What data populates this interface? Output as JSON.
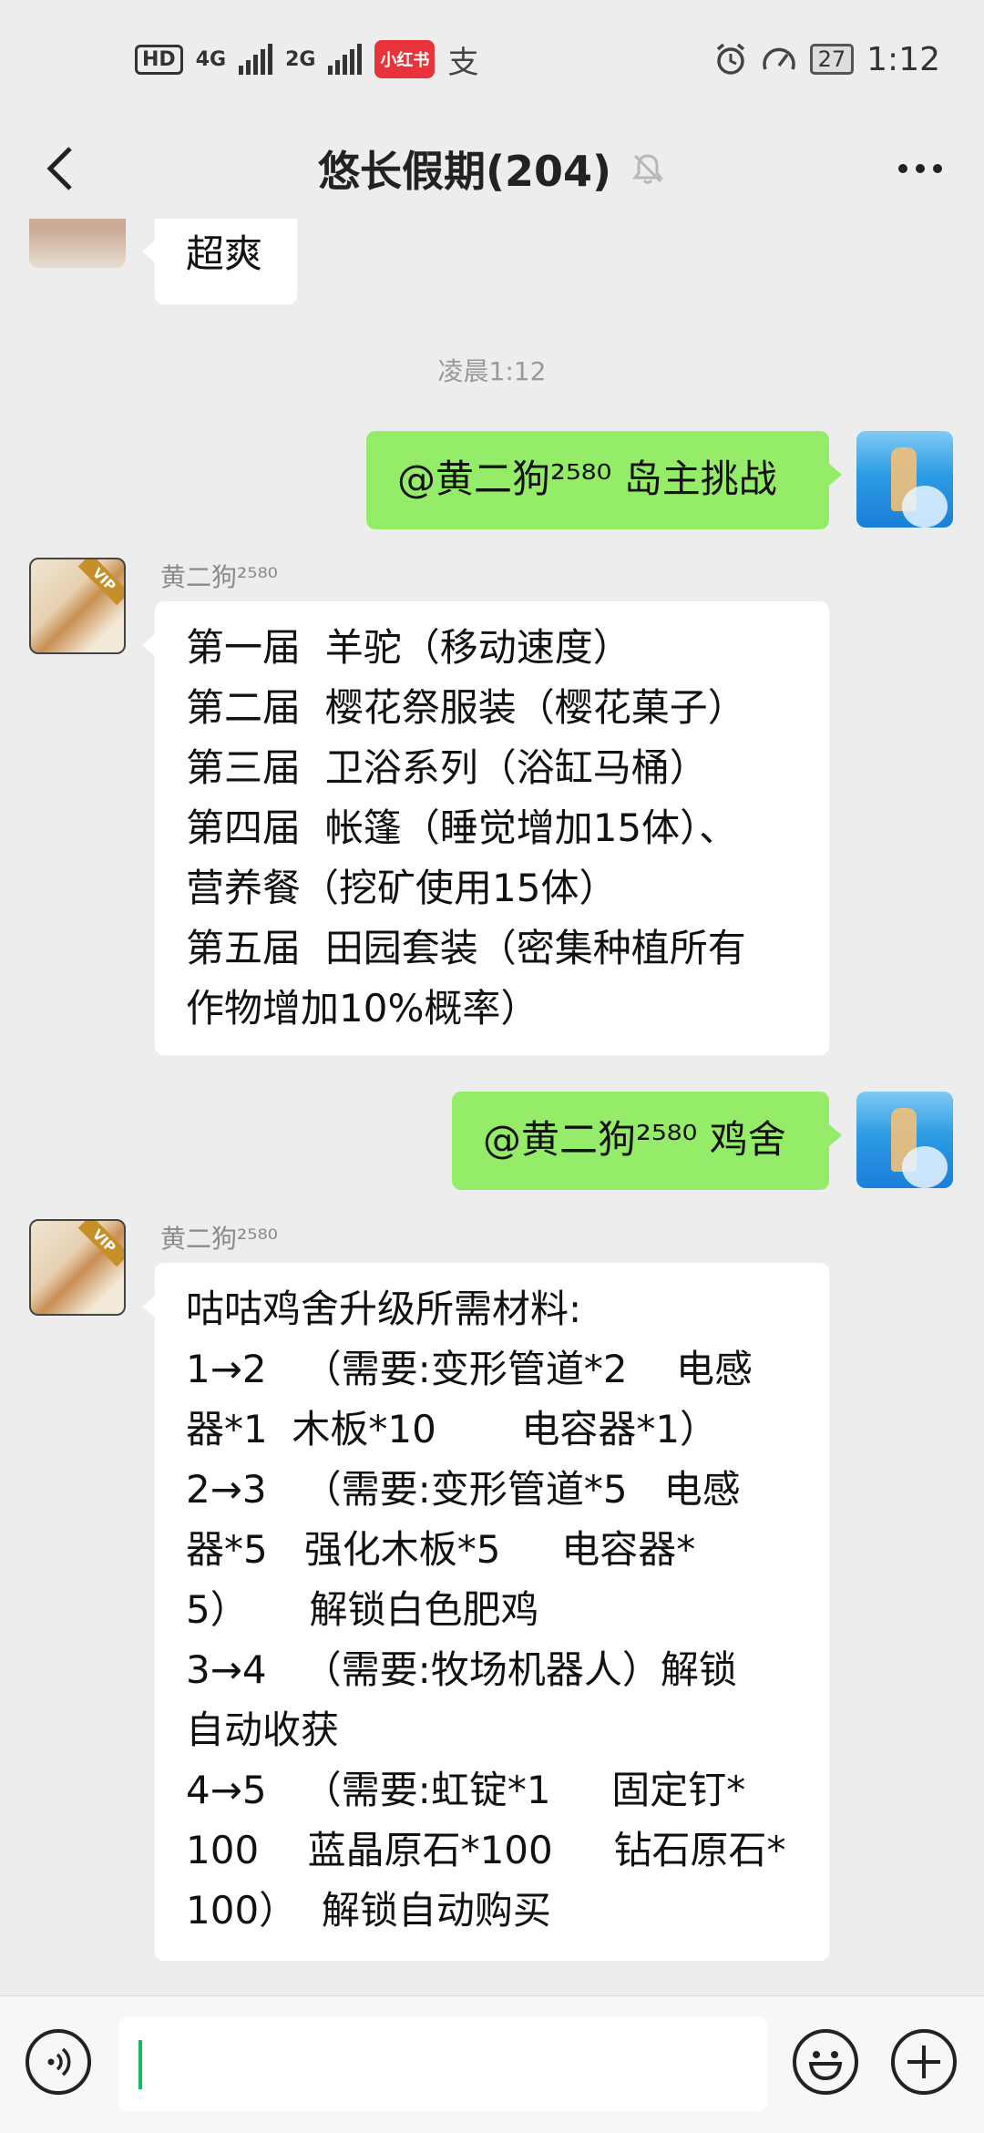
{
  "status_bar": {
    "hd": "HD",
    "net1": "4G",
    "net2": "2G",
    "app_badge": "小红书",
    "alipay_icon": "支",
    "battery": "27",
    "time": "1:12"
  },
  "header": {
    "title": "悠长假期(204)",
    "back_icon": "chevron-left-icon",
    "more_icon": "more-icon",
    "mute_icon": "bell-off-icon"
  },
  "messages": [
    {
      "type": "incoming",
      "text_lines": [
        "超爽"
      ]
    },
    {
      "type": "time",
      "text": "凌晨1:12"
    },
    {
      "type": "outgoing",
      "text_lines": [
        "@黄二狗²⁵⁸⁰ 岛主挑战"
      ]
    },
    {
      "type": "incoming",
      "sender": "黄二狗²⁵⁸⁰",
      "text_lines": [
        "第一届  羊驼（移动速度）",
        "第二届  樱花祭服装（樱花菓子）",
        "第三届  卫浴系列（浴缸马桶）",
        "第四届  帐篷（睡觉增加15体）、",
        "营养餐（挖矿使用15体）",
        "第五届  田园套装（密集种植所有",
        "作物增加10%概率）"
      ]
    },
    {
      "type": "outgoing",
      "text_lines": [
        "@黄二狗²⁵⁸⁰ 鸡舍"
      ]
    },
    {
      "type": "incoming",
      "sender": "黄二狗²⁵⁸⁰",
      "text_lines": [
        "咕咕鸡舍升级所需材料:",
        "1→2   （需要:变形管道*2    电感",
        "器*1  木板*10       电容器*1）",
        "2→3   （需要:变形管道*5   电感",
        "器*5   强化木板*5     电容器*",
        "5）     解锁白色肥鸡",
        "3→4   （需要:牧场机器人）解锁",
        "自动收获",
        "4→5   （需要:虹锭*1     固定钉*",
        "100    蓝晶原石*100     钻石原石*",
        "100）  解锁自动购买"
      ]
    }
  ],
  "input_bar": {
    "voice_icon": "voice-icon",
    "emoji_icon": "emoji-icon",
    "plus_icon": "plus-icon",
    "accent_color": "#07c160"
  },
  "colors": {
    "background": "#ededed",
    "outgoing_bubble": "#95ec69",
    "incoming_bubble": "#ffffff"
  }
}
